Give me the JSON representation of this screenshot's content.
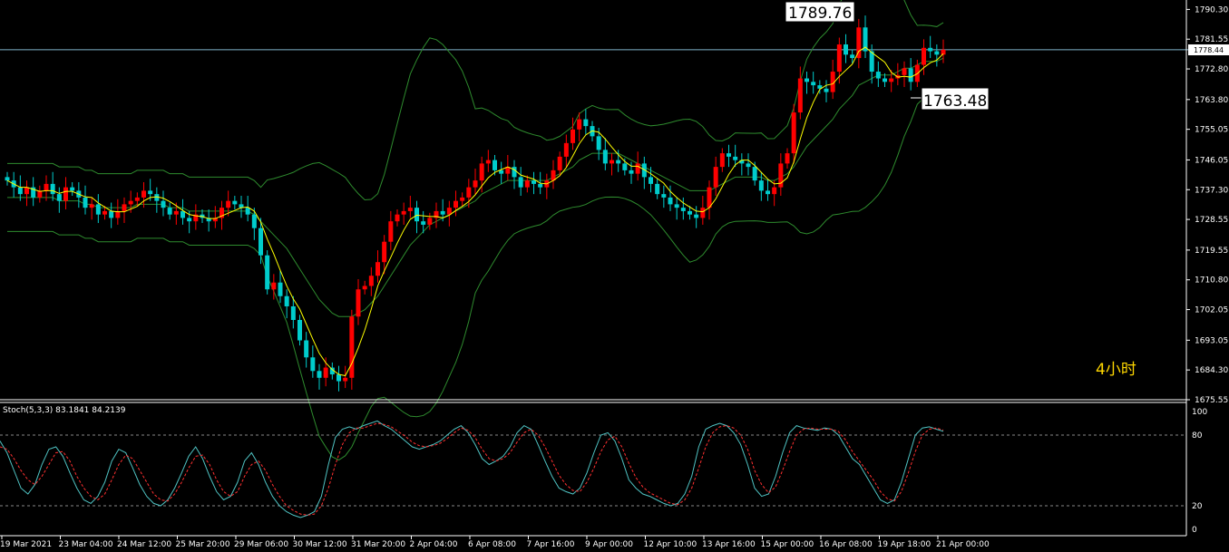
{
  "colors": {
    "background": "#000000",
    "bull": "#ff0000",
    "bear": "#00cccc",
    "bands": "#2e8b2e",
    "ma": "#ffff00",
    "k_line": "#4fc3c3",
    "d_line": "#ff3030",
    "grid_text": "#ffffff",
    "annotation": "#ffd700"
  },
  "price_labels": {
    "high": "1789.76",
    "low": "1763.48",
    "current": "1778.44"
  },
  "timeframe_label": "4小时",
  "oscillator_label": "Stoch(5,3,3) 83.1841 84.2139",
  "chart_data": [
    {
      "type": "candlestick",
      "ylim": [
        1675.55,
        1792.0
      ],
      "y_ticks": [
        "1790.30",
        "1781.55",
        "1772.80",
        "1763.80",
        "1755.05",
        "1746.05",
        "1737.30",
        "1728.55",
        "1719.55",
        "1710.80",
        "1702.05",
        "1693.05",
        "1684.30",
        "1675.55"
      ],
      "y_tick_values": [
        1790.3,
        1781.55,
        1772.8,
        1763.8,
        1755.05,
        1746.05,
        1737.3,
        1728.55,
        1719.55,
        1710.8,
        1702.05,
        1693.05,
        1684.3,
        1675.55
      ],
      "x_labels": [
        "19 Mar 2021",
        "23 Mar 04:00",
        "24 Mar 12:00",
        "25 Mar 20:00",
        "29 Mar 06:00",
        "30 Mar 12:00",
        "31 Mar 20:00",
        "2 Apr 04:00",
        "6 Apr 08:00",
        "7 Apr 16:00",
        "9 Apr 00:00",
        "12 Apr 10:00",
        "13 Apr 16:00",
        "15 Apr 00:00",
        "16 Apr 08:00",
        "19 Apr 18:00",
        "21 Apr 00:00"
      ],
      "annotations": [
        "1789.76",
        "1763.48"
      ],
      "current_price": 1778.44,
      "close": [
        1740,
        1738,
        1736,
        1738,
        1735,
        1737,
        1739,
        1736,
        1734,
        1738,
        1737,
        1735,
        1732,
        1733,
        1730,
        1731,
        1729,
        1731,
        1733,
        1734,
        1735,
        1737,
        1736,
        1734,
        1732,
        1730,
        1731,
        1729,
        1728,
        1730,
        1729,
        1728,
        1729,
        1732,
        1734,
        1733,
        1732,
        1730,
        1726,
        1718,
        1708,
        1710,
        1706,
        1703,
        1699,
        1693,
        1688,
        1684,
        1682,
        1685,
        1683,
        1681,
        1682,
        1700,
        1708,
        1709,
        1712,
        1716,
        1722,
        1728,
        1730,
        1731,
        1732,
        1728,
        1727,
        1729,
        1731,
        1730,
        1732,
        1734,
        1735,
        1738,
        1740,
        1745,
        1746,
        1743,
        1742,
        1744,
        1741,
        1738,
        1740,
        1739,
        1738,
        1740,
        1743,
        1747,
        1751,
        1755,
        1758,
        1756,
        1753,
        1749,
        1745,
        1746,
        1745,
        1743,
        1742,
        1745,
        1741,
        1739,
        1736,
        1735,
        1733,
        1732,
        1731,
        1730,
        1729,
        1732,
        1738,
        1744,
        1748,
        1747,
        1746,
        1745,
        1744,
        1740,
        1737,
        1736,
        1738,
        1745,
        1748,
        1760,
        1770,
        1769,
        1768,
        1767,
        1766,
        1772,
        1780,
        1777,
        1776,
        1785,
        1778,
        1772,
        1770,
        1769,
        1770,
        1771,
        1773,
        1769,
        1774,
        1779,
        1778,
        1777,
        1778.44
      ],
      "bb_mid": [
        1735,
        1735,
        1735,
        1735,
        1735,
        1735,
        1735,
        1735,
        1734,
        1734,
        1734,
        1734,
        1733,
        1733,
        1732,
        1732,
        1732,
        1732,
        1732,
        1732,
        1733,
        1733,
        1733,
        1733,
        1733,
        1732,
        1732,
        1732,
        1731,
        1731,
        1731,
        1731,
        1731,
        1731,
        1731,
        1731,
        1731,
        1731,
        1730,
        1728,
        1726,
        1724,
        1722,
        1720,
        1717,
        1714,
        1711,
        1708,
        1705,
        1703,
        1701,
        1700,
        1700,
        1700,
        1701,
        1702,
        1704,
        1706,
        1709,
        1712,
        1715,
        1718,
        1721,
        1723,
        1725,
        1727,
        1728,
        1729,
        1730,
        1731,
        1732,
        1733,
        1734,
        1736,
        1737,
        1738,
        1739,
        1740,
        1740,
        1740,
        1740,
        1740,
        1740,
        1740,
        1741,
        1742,
        1743,
        1744,
        1746,
        1747,
        1748,
        1748,
        1748,
        1748,
        1748,
        1747,
        1746,
        1745,
        1744,
        1743,
        1742,
        1741,
        1740,
        1739,
        1738,
        1737,
        1737,
        1737,
        1737,
        1738,
        1739,
        1740,
        1741,
        1741,
        1741,
        1741,
        1741,
        1740,
        1740,
        1741,
        1742,
        1744,
        1747,
        1750,
        1752,
        1754,
        1756,
        1758,
        1761,
        1763,
        1765,
        1768,
        1769,
        1770,
        1771,
        1771,
        1771,
        1772,
        1773,
        1773,
        1774,
        1775,
        1775,
        1775,
        1776
      ]
    },
    {
      "type": "line",
      "title": "Stoch(5,3,3) 83.1841 84.2139",
      "ylim": [
        0,
        100
      ],
      "y_ticks": [
        "100",
        "80",
        "20",
        "0"
      ],
      "y_tick_values": [
        100,
        80,
        20,
        0
      ],
      "levels": [
        80,
        20
      ],
      "series": [
        {
          "name": "",
          "values": [
            75,
            65,
            50,
            35,
            30,
            38,
            55,
            68,
            70,
            62,
            48,
            35,
            25,
            22,
            28,
            40,
            58,
            68,
            65,
            52,
            38,
            28,
            22,
            20,
            25,
            35,
            48,
            62,
            70,
            60,
            45,
            32,
            25,
            28,
            40,
            58,
            65,
            55,
            40,
            28,
            20,
            15,
            12,
            10,
            12,
            15,
            28,
            55,
            78,
            85,
            87,
            85,
            88,
            90,
            92,
            88,
            85,
            80,
            75,
            70,
            68,
            70,
            72,
            75,
            80,
            85,
            88,
            82,
            72,
            60,
            55,
            58,
            62,
            70,
            82,
            88,
            85,
            72,
            58,
            45,
            35,
            32,
            30,
            35,
            48,
            65,
            80,
            82,
            75,
            60,
            42,
            35,
            30,
            28,
            25,
            22,
            20,
            22,
            30,
            45,
            70,
            85,
            88,
            90,
            88,
            82,
            72,
            55,
            35,
            28,
            30,
            45,
            65,
            82,
            88,
            86,
            85,
            84,
            86,
            85,
            80,
            70,
            60,
            55,
            45,
            35,
            25,
            22,
            25,
            40,
            60,
            80,
            86,
            87,
            85,
            83.18
          ]
        },
        {
          "name": "",
          "values": [
            70,
            68,
            60,
            50,
            42,
            38,
            45,
            55,
            65,
            66,
            58,
            45,
            35,
            28,
            25,
            30,
            42,
            55,
            63,
            60,
            50,
            40,
            30,
            25,
            24,
            30,
            40,
            52,
            62,
            63,
            55,
            42,
            32,
            28,
            32,
            45,
            55,
            58,
            50,
            38,
            28,
            20,
            16,
            13,
            12,
            13,
            20,
            35,
            55,
            72,
            82,
            86,
            86,
            88,
            90,
            89,
            87,
            83,
            79,
            74,
            71,
            70,
            71,
            73,
            77,
            82,
            86,
            84,
            78,
            68,
            60,
            58,
            60,
            65,
            74,
            82,
            85,
            80,
            70,
            58,
            46,
            38,
            33,
            32,
            40,
            52,
            66,
            76,
            79,
            70,
            56,
            44,
            36,
            31,
            28,
            25,
            22,
            21,
            25,
            35,
            52,
            70,
            82,
            87,
            88,
            86,
            80,
            68,
            50,
            38,
            31,
            36,
            50,
            66,
            80,
            85,
            86,
            85,
            85,
            85,
            83,
            76,
            66,
            58,
            50,
            42,
            32,
            26,
            24,
            32,
            48,
            66,
            80,
            85,
            86,
            84.21
          ]
        }
      ]
    }
  ]
}
